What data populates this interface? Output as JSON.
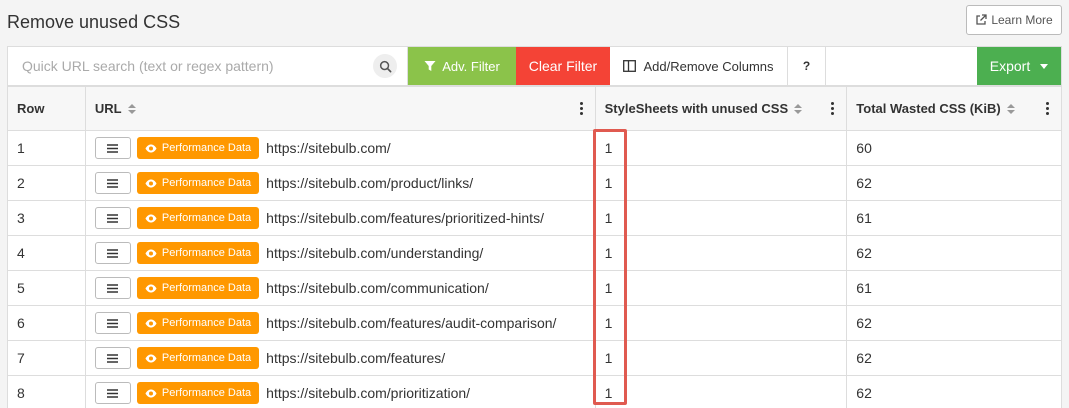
{
  "page": {
    "title": "Remove unused CSS"
  },
  "header": {
    "learn_more_label": "Learn More"
  },
  "toolbar": {
    "search_placeholder": "Quick URL search (text or regex pattern)",
    "search_value": "",
    "adv_filter_label": "Adv. Filter",
    "clear_filter_label": "Clear Filter",
    "columns_label": "Add/Remove Columns",
    "help_label": "?",
    "export_label": "Export"
  },
  "table": {
    "columns": [
      "Row",
      "URL",
      "StyleSheets with unused CSS",
      "Total Wasted CSS (KiB)"
    ],
    "perf_label": "Performance Data",
    "rows": [
      {
        "row": "1",
        "url": "https://sitebulb.com/",
        "stylesheets": "1",
        "wasted": "60"
      },
      {
        "row": "2",
        "url": "https://sitebulb.com/product/links/",
        "stylesheets": "1",
        "wasted": "62"
      },
      {
        "row": "3",
        "url": "https://sitebulb.com/features/prioritized-hints/",
        "stylesheets": "1",
        "wasted": "61"
      },
      {
        "row": "4",
        "url": "https://sitebulb.com/understanding/",
        "stylesheets": "1",
        "wasted": "62"
      },
      {
        "row": "5",
        "url": "https://sitebulb.com/communication/",
        "stylesheets": "1",
        "wasted": "61"
      },
      {
        "row": "6",
        "url": "https://sitebulb.com/features/audit-comparison/",
        "stylesheets": "1",
        "wasted": "62"
      },
      {
        "row": "7",
        "url": "https://sitebulb.com/features/",
        "stylesheets": "1",
        "wasted": "62"
      },
      {
        "row": "8",
        "url": "https://sitebulb.com/prioritization/",
        "stylesheets": "1",
        "wasted": "62"
      }
    ]
  },
  "colors": {
    "adv_filter": "#8bc34a",
    "clear_filter": "#f44336",
    "export": "#4caf50",
    "performance": "#ff9800",
    "highlight": "#e05a50"
  }
}
